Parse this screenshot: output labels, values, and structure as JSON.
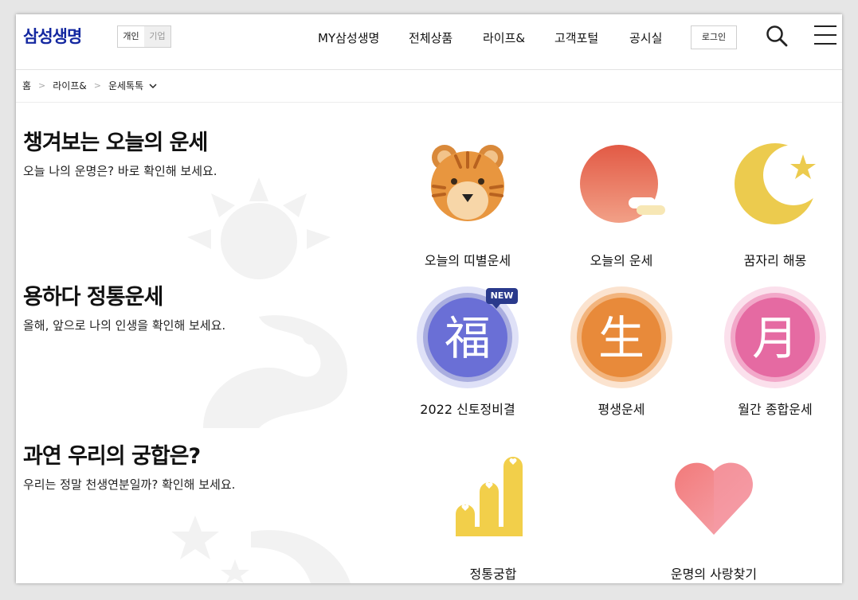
{
  "header": {
    "logo": "삼성생명",
    "segments": [
      "개인",
      "기업"
    ],
    "nav": [
      "MY삼성생명",
      "전체상품",
      "라이프&",
      "고객포털",
      "공시실"
    ],
    "login_label": "로그인",
    "search_icon": "search-icon",
    "menu_icon": "hamburger-menu-icon"
  },
  "breadcrumb": {
    "items": [
      "홈",
      "라이프&",
      "운세톡톡"
    ]
  },
  "sections": [
    {
      "title": "챙겨보는 오늘의 운세",
      "subtitle": "오늘 나의 운명은? 바로 확인해 보세요.",
      "items": [
        "오늘의 띠별운세",
        "오늘의 운세",
        "꿈자리 해몽"
      ]
    },
    {
      "title": "용하다 정통운세",
      "subtitle": "올해, 앞으로 나의 인생을 확인해 보세요.",
      "items": [
        "2022 신토정비결",
        "평생운세",
        "월간 종합운세"
      ],
      "badge": "NEW",
      "glyphs": [
        "福",
        "生",
        "月"
      ]
    },
    {
      "title": "과연 우리의 궁합은?",
      "subtitle": "우리는 정말 천생연분일까? 확인해 보세요.",
      "items": [
        "정통궁합",
        "운명의 사랑찾기"
      ]
    }
  ],
  "colors": {
    "brand": "#1428a0",
    "badge": "#2a3a8c",
    "bok": "#6a6fd6",
    "saeng": "#e88a3a",
    "wol": "#e56aa2"
  }
}
